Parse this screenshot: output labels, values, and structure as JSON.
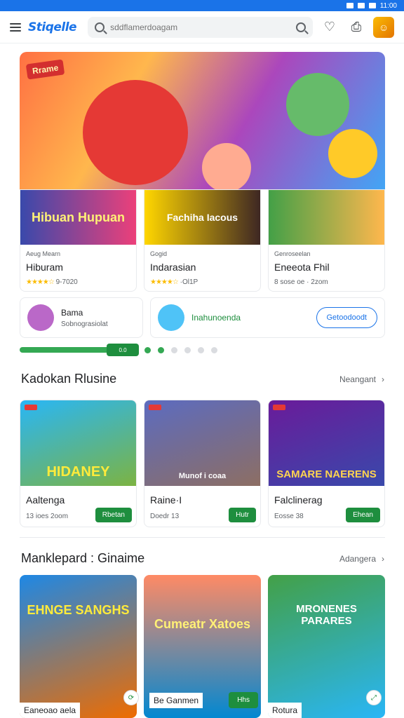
{
  "app": {
    "logo": "Stiqelle",
    "search_placeholder": "sddflamerdoagam",
    "avatar_glyph": "☺"
  },
  "hero": {
    "badge": "Rrame"
  },
  "featured": [
    {
      "art_text": "Hibuan Hupuan",
      "category": "Aeug Mearn",
      "name": "Hiburam",
      "rating_stars": "★★★★☆",
      "sub": "9-7020"
    },
    {
      "art_text": "Fachiha Iacous",
      "category": "Gogid",
      "name": "Indarasian",
      "rating_stars": "★★★★☆",
      "sub": "·Ol1P"
    },
    {
      "art_text": "",
      "category": "Genroseelan",
      "name": "Eneeota Fhil",
      "rating_stars": "",
      "sub": "8 sose oe · 2zom"
    }
  ],
  "chips": {
    "a": {
      "title": "Bama",
      "subtitle": "Sobnograsiolat"
    },
    "b": {
      "text": "Inahunoenda",
      "button": "Getoodoodt"
    }
  },
  "pager": {
    "knob": "0.0"
  },
  "section1": {
    "title": "Kadokan Rlusine",
    "more": "Neangant",
    "cards": [
      {
        "art_text": "HIDANEY",
        "name": "Aaltenga",
        "sub": "13 ioes 2oom",
        "button": "Rbetan"
      },
      {
        "art_text": "Munof i coaa",
        "name": "Raine·I",
        "sub": "Doedr 13",
        "button": "Hutr"
      },
      {
        "art_text": "SAMARE NAERENS",
        "name": "Falclinerag",
        "sub": "Eosse 38",
        "button": "Ehean"
      }
    ]
  },
  "section2": {
    "title": "Manklepard : Ginaime",
    "more": "Adangera",
    "cards": [
      {
        "art_text": "EHNGE SANGHS",
        "label": "Eaneoao aela"
      },
      {
        "art_text": "Cumeatr Xatoes",
        "label": "Be Ganmen",
        "button": "Hhs"
      },
      {
        "art_text": "MRONENES PARARES",
        "label": "Rotura"
      }
    ]
  },
  "colors": {
    "accent": "#1a73e8",
    "green": "#1e8e3e",
    "star": "#fbbc04"
  }
}
